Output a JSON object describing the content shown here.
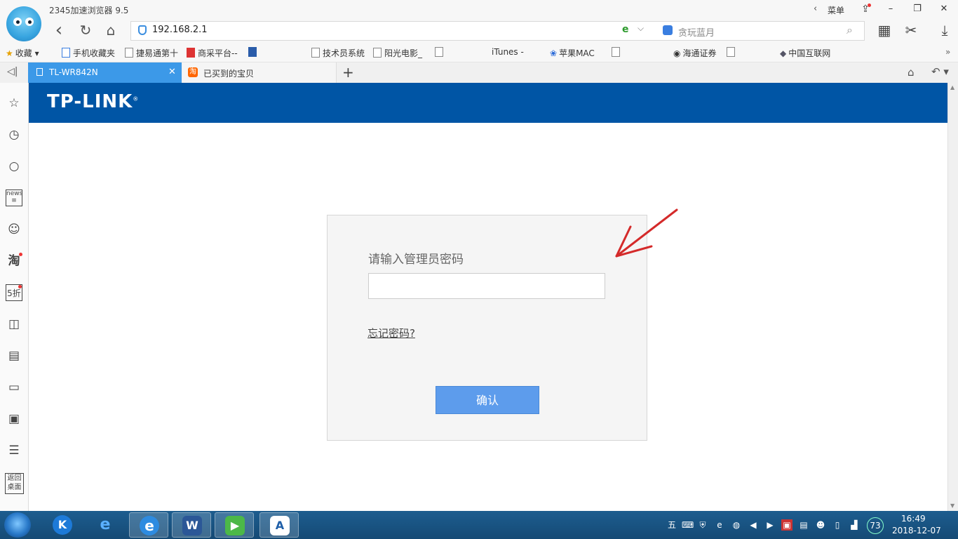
{
  "window": {
    "app_title": "2345加速浏览器 9.5",
    "menu_label": "菜单",
    "minimize": "–",
    "maximize": "❐",
    "close": "✕"
  },
  "nav": {
    "back": "‹",
    "refresh": "↻",
    "home": "⌂",
    "address": "192.168.2.1",
    "engine_badge": "e",
    "search_placeholder": "贪玩蓝月"
  },
  "bookmarks": [
    "收藏",
    "手机收藏夹",
    "捷易通第十",
    "商采平台--",
    "技术员系统",
    "阳光电影_",
    "iTunes -",
    "苹果MAC",
    "海通证券",
    "中国互联网"
  ],
  "tabs": [
    {
      "label": "TL-WR842N",
      "active": true
    },
    {
      "label": "已买到的宝贝",
      "active": false
    }
  ],
  "page": {
    "brand": "TP-LINK",
    "brand_mark": "®",
    "password_label": "请输入管理员密码",
    "password_value": "",
    "forgot_link": "忘记密码?",
    "confirm_button": "确认"
  },
  "sidebar_icons": [
    "star-icon",
    "clock-icon",
    "search-icon",
    "news-icon",
    "chat-icon",
    "taobao-icon",
    "discount-icon",
    "gamepad-icon",
    "film-icon",
    "tv-icon",
    "calculator-icon",
    "list-icon",
    "return-desktop-icon"
  ],
  "sidebar_return_label": "返回桌面",
  "taskbar": {
    "time": "16:49",
    "date": "2018-12-07",
    "battery_badge": "73"
  },
  "colors": {
    "banner": "#0055a5",
    "active_tab": "#3c99e8",
    "confirm_button": "#5d9cec",
    "annotation_arrow": "#d42a2a"
  }
}
